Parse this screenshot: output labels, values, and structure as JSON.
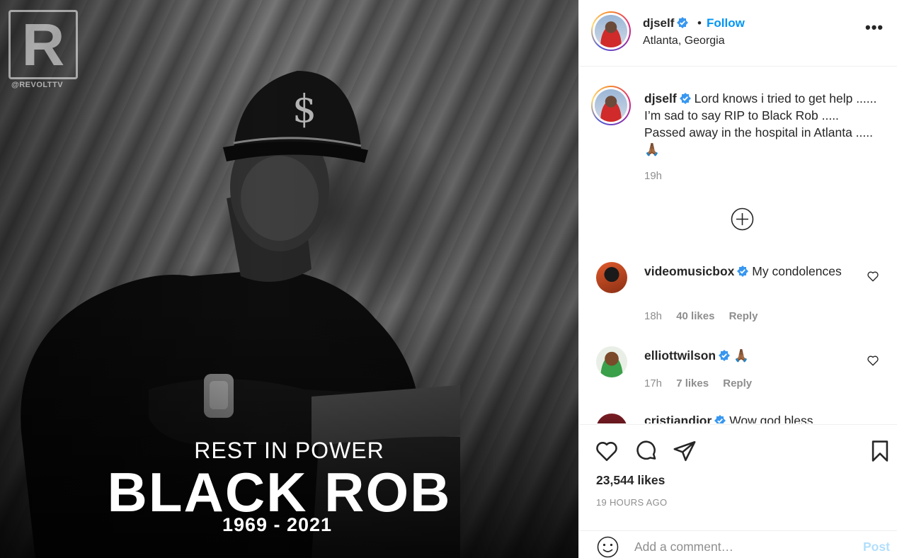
{
  "media": {
    "watermark_letter": "R",
    "watermark_text": "@REVOLTTV",
    "overlay_line1": "REST IN POWER",
    "overlay_line2": "BLACK ROB",
    "overlay_line3": "1969 - 2021"
  },
  "header": {
    "username": "djself",
    "verified_icon": "verified-badge-icon",
    "separator": "•",
    "follow_label": "Follow",
    "location": "Atlanta, Georgia",
    "more_label": "•••"
  },
  "caption": {
    "username": "djself",
    "text": "Lord knows i tried to get help ...... I’m sad to say RIP to Black Rob ..... Passed away in the hospital in Atlanta .....🙏🏾",
    "time": "19h"
  },
  "comments": [
    {
      "username": "videomusicbox",
      "text": "My condolences",
      "time": "18h",
      "likes": "40 likes",
      "reply_label": "Reply"
    },
    {
      "username": "elliottwilson",
      "text": "🙏🏾",
      "time": "17h",
      "likes": "7 likes",
      "reply_label": "Reply"
    },
    {
      "username": "cristiandior",
      "text": "Wow god bless"
    }
  ],
  "actions": {
    "likes_count": "23,544 likes",
    "post_age": "19 HOURS AGO"
  },
  "add_comment": {
    "placeholder": "Add a comment…",
    "post_label": "Post"
  },
  "colors": {
    "link_blue": "#0095f6",
    "muted_text": "#8e8e8e",
    "post_disabled": "#b2dffc"
  }
}
